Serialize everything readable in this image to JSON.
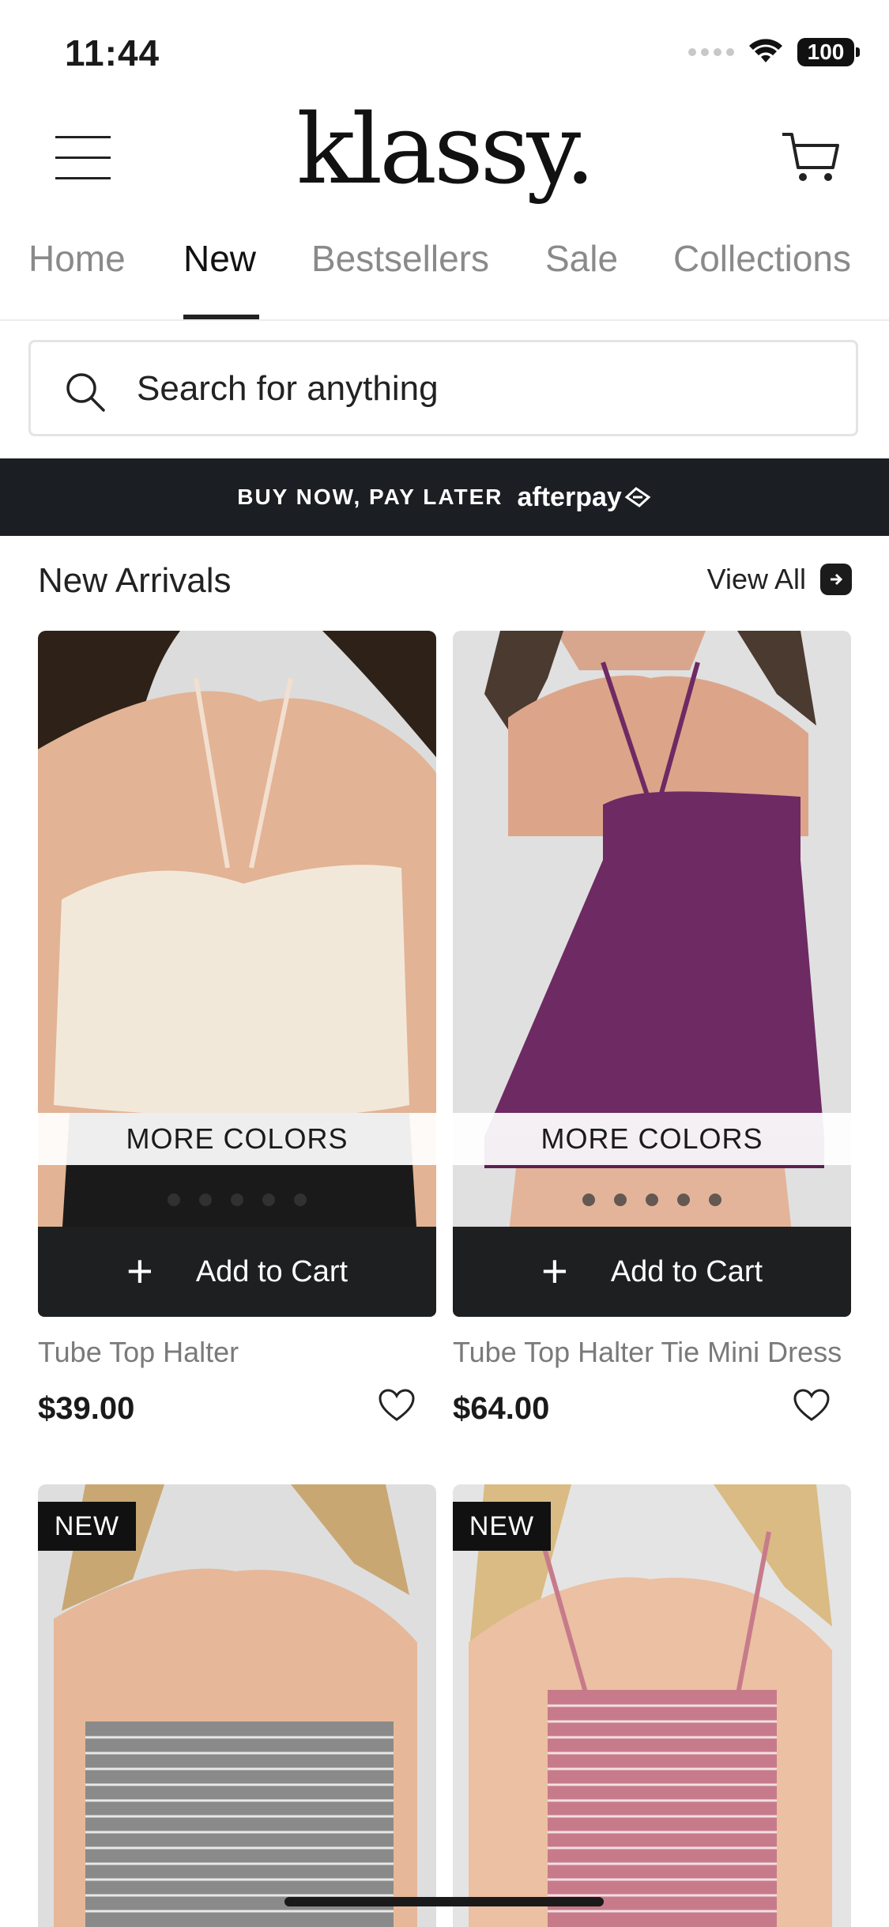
{
  "status_bar": {
    "time": "11:44",
    "battery": "100"
  },
  "header": {
    "logo": "klassy."
  },
  "tabs": [
    {
      "label": "Home"
    },
    {
      "label": "New"
    },
    {
      "label": "Bestsellers"
    },
    {
      "label": "Sale"
    },
    {
      "label": "Collections"
    }
  ],
  "active_tab": "New",
  "search": {
    "placeholder": "Search for anything"
  },
  "promo": {
    "text": "BUY NOW, PAY LATER",
    "brand": "afterpay"
  },
  "new_arrivals": {
    "title": "New Arrivals",
    "view_all": "View All",
    "products": [
      {
        "name": "Tube Top Halter",
        "price": "$39.00",
        "more_colors": "MORE COLORS",
        "add_to_cart": "Add to Cart",
        "image": "cream halter top on model",
        "color": "#efe5d6"
      },
      {
        "name": "Tube Top Halter Tie Mini Dress",
        "price": "$64.00",
        "more_colors": "MORE COLORS",
        "add_to_cart": "Add to Cart",
        "image": "purple halter mini dress on model",
        "color": "#6e2a63"
      }
    ],
    "next_row": [
      {
        "badge": "NEW",
        "image": "black and white gingham strapless top",
        "color": "#6b6b6b"
      },
      {
        "badge": "NEW",
        "image": "red gingham halter top",
        "color": "#c77b8a"
      }
    ]
  }
}
